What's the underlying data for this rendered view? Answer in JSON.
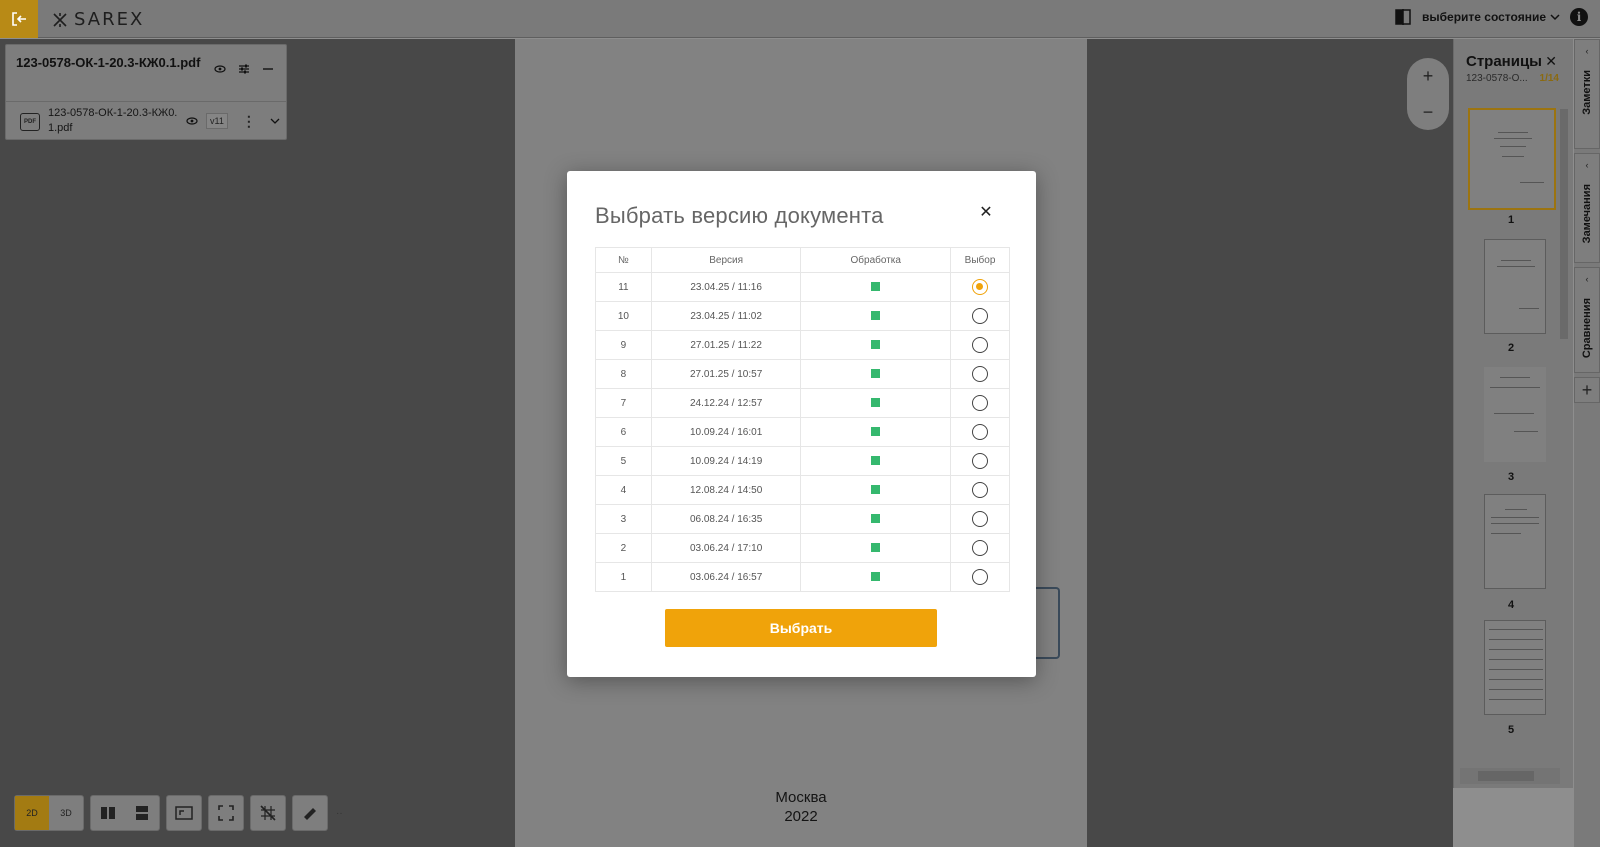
{
  "topbar": {
    "logo": "SAREX",
    "state_select": "выберите состояние"
  },
  "file_panel": {
    "title": "123-0578-ОК-1-20.3-КЖ0.1.pdf",
    "file_name": "123-0578-ОК-1-20.3-КЖ0.1.pdf",
    "file_icon_label": "PDF",
    "version_badge": "v11"
  },
  "document": {
    "city": "Москва",
    "year": "2022"
  },
  "pages_panel": {
    "title": "Страницы",
    "subtitle": "123-0578-О...",
    "page_counter": "1/14",
    "pages": [
      {
        "num": "1",
        "active": true
      },
      {
        "num": "2",
        "active": false
      },
      {
        "num": "3",
        "active": false
      },
      {
        "num": "4",
        "active": false
      },
      {
        "num": "5",
        "active": false
      }
    ]
  },
  "side_tabs": [
    "Заметки",
    "Замечания",
    "Сравнения"
  ],
  "toolbar": {
    "mode_2d": "2D",
    "mode_3d": "3D"
  },
  "modal": {
    "title": "Выбрать версию документа",
    "columns": [
      "№",
      "Версия",
      "Обработка",
      "Выбор"
    ],
    "rows": [
      {
        "num": "11",
        "version": "23.04.25 / 11:16",
        "selected": true
      },
      {
        "num": "10",
        "version": "23.04.25 / 11:02",
        "selected": false
      },
      {
        "num": "9",
        "version": "27.01.25 / 11:22",
        "selected": false
      },
      {
        "num": "8",
        "version": "27.01.25 / 10:57",
        "selected": false
      },
      {
        "num": "7",
        "version": "24.12.24 / 12:57",
        "selected": false
      },
      {
        "num": "6",
        "version": "10.09.24 / 16:01",
        "selected": false
      },
      {
        "num": "5",
        "version": "10.09.24 / 14:19",
        "selected": false
      },
      {
        "num": "4",
        "version": "12.08.24 / 14:50",
        "selected": false
      },
      {
        "num": "3",
        "version": "06.08.24 / 16:35",
        "selected": false
      },
      {
        "num": "2",
        "version": "03.06.24 / 17:10",
        "selected": false
      },
      {
        "num": "1",
        "version": "03.06.24 / 16:57",
        "selected": false
      }
    ],
    "processing_color": "#35b86e",
    "select_button": "Выбрать"
  },
  "colors": {
    "accent": "#f0a30a",
    "processed": "#35b86e"
  }
}
